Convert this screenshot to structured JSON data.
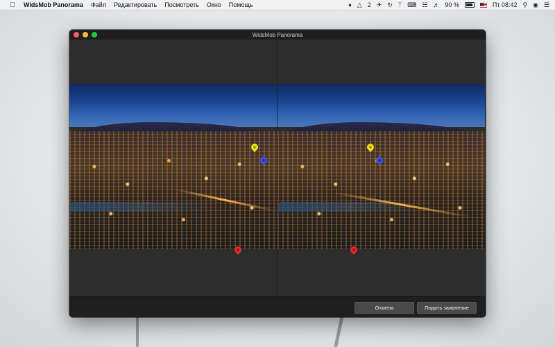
{
  "menubar": {
    "app_name": "WidsMob Panorama",
    "menus": [
      "Файл",
      "Редактировать",
      "Посмотреть",
      "Окно",
      "Помощь"
    ],
    "status": {
      "badge_count": "2",
      "battery_percent": "90 %",
      "clock": "Пт 08:42"
    }
  },
  "window": {
    "title": "WidsMob Panorama"
  },
  "footer": {
    "cancel_label": "Отмена",
    "submit_label": "Подать заявление"
  },
  "colors": {
    "pin_yellow": "#f2e21a",
    "pin_blue": "#3b4fe4",
    "pin_red": "#e12b2b",
    "traffic_close": "#fc5f57",
    "traffic_min": "#fdbc2e",
    "traffic_max": "#28c840"
  }
}
